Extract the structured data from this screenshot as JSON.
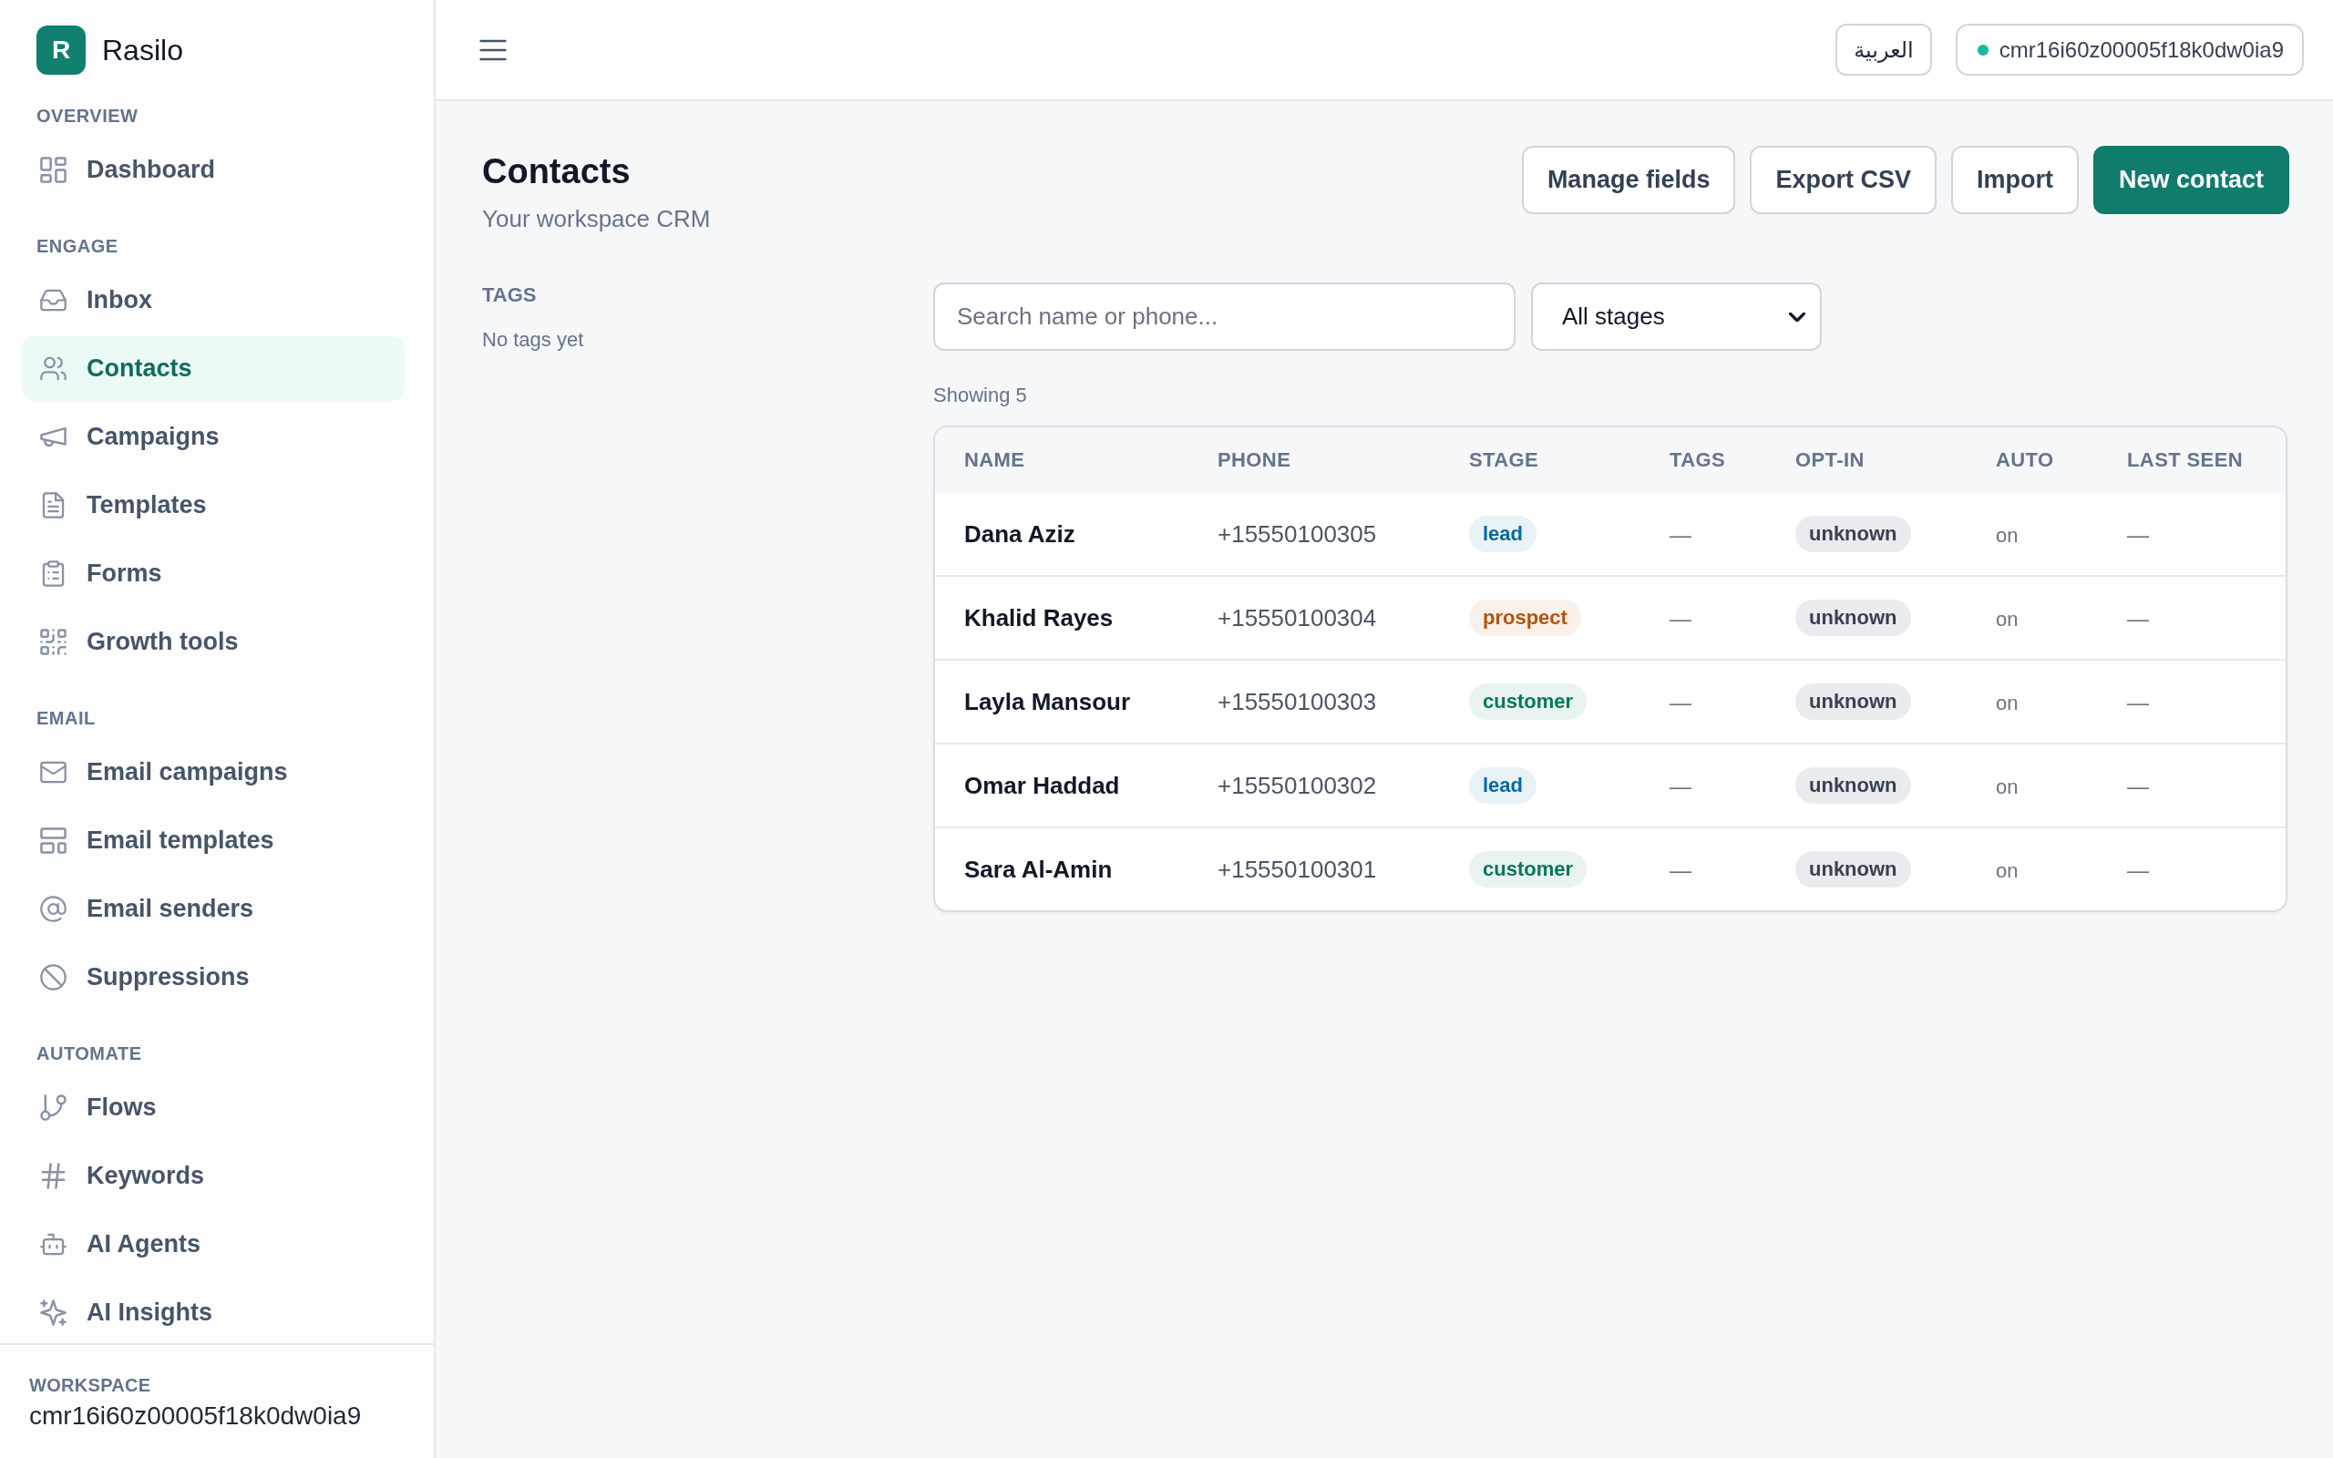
{
  "sidebar": {
    "brand": {
      "logo_letter": "R",
      "name": "Rasilo"
    },
    "sections": [
      {
        "label": "OVERVIEW",
        "items": [
          {
            "label": "Dashboard",
            "selected": false
          }
        ]
      },
      {
        "label": "ENGAGE",
        "items": [
          {
            "label": "Inbox",
            "selected": false
          },
          {
            "label": "Contacts",
            "selected": true
          },
          {
            "label": "Campaigns",
            "selected": false
          },
          {
            "label": "Templates",
            "selected": false
          },
          {
            "label": "Forms",
            "selected": false
          },
          {
            "label": "Growth tools",
            "selected": false
          }
        ]
      },
      {
        "label": "EMAIL",
        "items": [
          {
            "label": "Email campaigns",
            "selected": false
          },
          {
            "label": "Email templates",
            "selected": false
          },
          {
            "label": "Email senders",
            "selected": false
          },
          {
            "label": "Suppressions",
            "selected": false
          }
        ]
      },
      {
        "label": "AUTOMATE",
        "items": [
          {
            "label": "Flows",
            "selected": false
          },
          {
            "label": "Keywords",
            "selected": false
          },
          {
            "label": "AI Agents",
            "selected": false
          },
          {
            "label": "AI Insights",
            "selected": false
          }
        ]
      }
    ],
    "workspace": {
      "label": "WORKSPACE",
      "value": "cmr16i60z00005f18k0dw0ia9"
    }
  },
  "topbar": {
    "language_button": "العربية",
    "workspace_pill": "cmr16i60z00005f18k0dw0ia9"
  },
  "page": {
    "title": "Contacts",
    "subtitle": "Your workspace CRM",
    "actions": [
      {
        "label": "Manage fields",
        "kind": "secondary"
      },
      {
        "label": "Export CSV",
        "kind": "secondary"
      },
      {
        "label": "Import",
        "kind": "secondary"
      },
      {
        "label": "New contact",
        "kind": "primary"
      }
    ]
  },
  "tags_panel": {
    "heading": "TAGS",
    "empty_text": "No tags yet"
  },
  "filters": {
    "search": {
      "placeholder": "Search name or phone..."
    },
    "stage_select": {
      "value": "All stages"
    }
  },
  "results": {
    "count_text": "Showing 5"
  },
  "table": {
    "columns": [
      "NAME",
      "PHONE",
      "STAGE",
      "TAGS",
      "OPT-IN",
      "AUTO",
      "LAST SEEN"
    ],
    "rows": [
      {
        "name": "Dana Aziz",
        "phone": "+15550100305",
        "stage": {
          "label": "lead",
          "color": "#0369a1"
        },
        "tags": "—",
        "opt_in": "unknown",
        "auto": "on",
        "last_seen": "—"
      },
      {
        "name": "Khalid Rayes",
        "phone": "+15550100304",
        "stage": {
          "label": "prospect",
          "color": "#b45309"
        },
        "tags": "—",
        "opt_in": "unknown",
        "auto": "on",
        "last_seen": "—"
      },
      {
        "name": "Layla Mansour",
        "phone": "+15550100303",
        "stage": {
          "label": "customer",
          "color": "#047857"
        },
        "tags": "—",
        "opt_in": "unknown",
        "auto": "on",
        "last_seen": "—"
      },
      {
        "name": "Omar Haddad",
        "phone": "+15550100302",
        "stage": {
          "label": "lead",
          "color": "#0369a1"
        },
        "tags": "—",
        "opt_in": "unknown",
        "auto": "on",
        "last_seen": "—"
      },
      {
        "name": "Sara Al-Amin",
        "phone": "+15550100301",
        "stage": {
          "label": "customer",
          "color": "#047857"
        },
        "tags": "—",
        "opt_in": "unknown",
        "auto": "on",
        "last_seen": "—"
      }
    ]
  }
}
